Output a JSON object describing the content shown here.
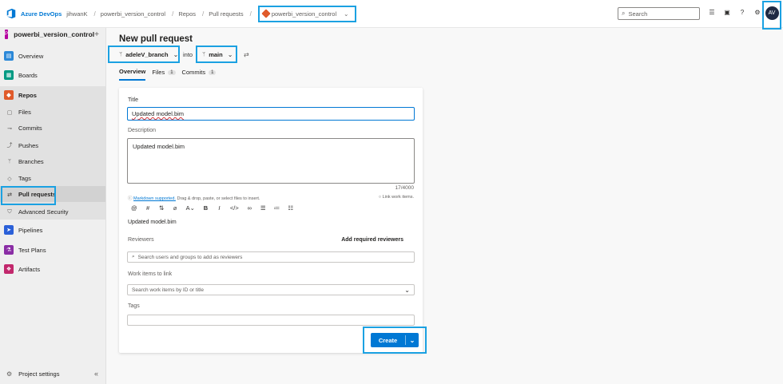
{
  "topbar": {
    "org": "Azure DevOps",
    "user": "jihwanK",
    "crumbs": [
      "powerbi_version_control",
      "Repos",
      "Pull requests"
    ],
    "repo": "powerbi_version_control",
    "search_placeholder": "Search",
    "avatar_initials": "AV"
  },
  "sidebar": {
    "project_initial": "P",
    "project_name": "powerbi_version_control",
    "items": [
      {
        "label": "Overview",
        "icon": "overview-icon",
        "color": "#2b88d8"
      },
      {
        "label": "Boards",
        "icon": "boards-icon",
        "color": "#009a83"
      },
      {
        "label": "Repos",
        "icon": "repos-icon",
        "color": "#e05a2a"
      },
      {
        "label": "Files",
        "icon": "files-icon"
      },
      {
        "label": "Commits",
        "icon": "commits-icon"
      },
      {
        "label": "Pushes",
        "icon": "pushes-icon"
      },
      {
        "label": "Branches",
        "icon": "branches-icon"
      },
      {
        "label": "Tags",
        "icon": "tags-icon"
      },
      {
        "label": "Pull requests",
        "icon": "pull-requests-icon"
      },
      {
        "label": "Advanced Security",
        "icon": "shield-icon"
      },
      {
        "label": "Pipelines",
        "icon": "pipelines-icon",
        "color": "#2b60d8"
      },
      {
        "label": "Test Plans",
        "icon": "test-plans-icon",
        "color": "#8a2da5"
      },
      {
        "label": "Artifacts",
        "icon": "artifacts-icon",
        "color": "#c2286c"
      }
    ],
    "project_settings": "Project settings"
  },
  "main": {
    "title": "New pull request",
    "source_branch": "adeleV_branch",
    "into": "into",
    "target_branch": "main",
    "tabs": [
      {
        "label": "Overview",
        "count": ""
      },
      {
        "label": "Files",
        "count": "1"
      },
      {
        "label": "Commits",
        "count": "1"
      }
    ],
    "form": {
      "title_label": "Title",
      "title_value": "Updated model.bim",
      "description_label": "Description",
      "description_value": "Updated model.bim",
      "char_count": "17/4000",
      "markdown_link": "Markdown supported.",
      "markdown_note": " Drag & drop, paste, or select files to insert.",
      "link_work_items": "Link work items.",
      "preview_text": "Updated model.bim",
      "reviewers_label": "Reviewers",
      "add_required_reviewers": "Add required reviewers",
      "reviewers_placeholder": "Search users and groups to add as reviewers",
      "work_items_label": "Work items to link",
      "work_items_placeholder": "Search work items by ID or title",
      "tags_label": "Tags",
      "create_label": "Create"
    }
  }
}
